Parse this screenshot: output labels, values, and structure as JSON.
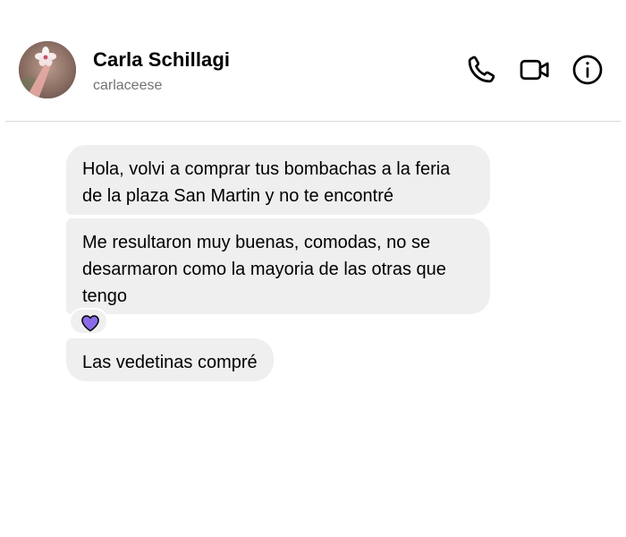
{
  "header": {
    "name": "Carla Schillagi",
    "username": "carlaceese",
    "icons": [
      "phone-icon",
      "video-camera-icon",
      "info-icon"
    ]
  },
  "messages": [
    {
      "text": "Hola, volvi a comprar tus bombachas a la feria de la plaza San Martin y no te encontré"
    },
    {
      "text": "Me resultaron muy buenas, comodas, no se desarmaron como la mayoria de las otras que tengo",
      "reaction": "heart-icon"
    },
    {
      "text": "Las vedetinas compré"
    }
  ],
  "colors": {
    "bubble": "#efefef",
    "reaction_heart": "#8b6be6",
    "username": "#737373",
    "divider": "#dbdbdb"
  }
}
